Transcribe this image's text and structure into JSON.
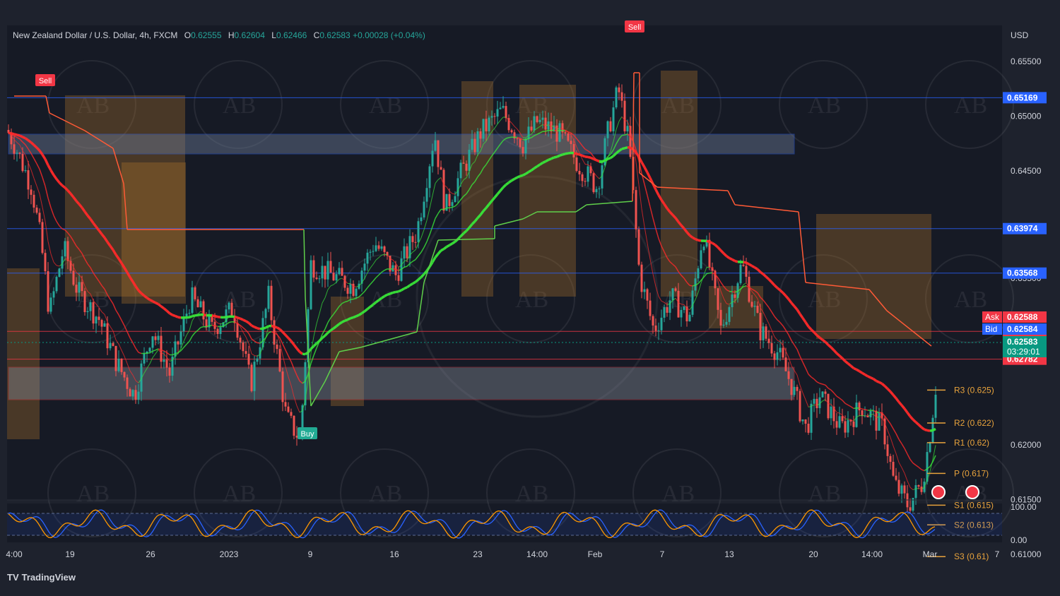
{
  "header": {
    "symbol": "New Zealand Dollar / U.S. Dollar, 4h, FXCM",
    "o_label": "O",
    "o": "0.62555",
    "h_label": "H",
    "h": "0.62604",
    "l_label": "L",
    "l": "0.62466",
    "c_label": "C",
    "c": "0.62583",
    "change": "+0.00028 (+0.04%)"
  },
  "currency": "USD",
  "price_axis": [
    "0.65500",
    "0.65000",
    "0.64500",
    "0.63500",
    "0.62000",
    "0.61500",
    "0.61000"
  ],
  "price_tags": [
    {
      "text": "0.65169",
      "color": "#2962ff",
      "value": 0.65169
    },
    {
      "text": "0.63974",
      "color": "#2962ff",
      "value": 0.63974
    },
    {
      "text": "0.63568",
      "color": "#2962ff",
      "value": 0.63568
    },
    {
      "text": "0.63036",
      "color": "#f23645",
      "value": 0.63036
    },
    {
      "text": "0.62782",
      "color": "#f23645",
      "value": 0.62782
    }
  ],
  "ask": {
    "label": "Ask",
    "value": "0.62588",
    "color": "#f23645"
  },
  "bid": {
    "label": "Bid",
    "value": "0.62584",
    "color": "#2962ff"
  },
  "last": {
    "value": "0.62583",
    "countdown": "03:29:01",
    "color": "#089981"
  },
  "pivots": [
    {
      "label": "R3 (0.625)",
      "value": 0.625
    },
    {
      "label": "R2 (0.622)",
      "value": 0.622
    },
    {
      "label": "R1 (0.62)",
      "value": 0.6202
    },
    {
      "label": "P (0.617)",
      "value": 0.6174
    },
    {
      "label": "S1 (0.615)",
      "value": 0.6145
    },
    {
      "label": "S2 (0.613)",
      "value": 0.6127
    },
    {
      "label": "S3 (0.61)",
      "value": 0.6098
    }
  ],
  "signals": {
    "sell": "Sell",
    "buy": "Buy"
  },
  "time_axis": [
    "4:00",
    "19",
    "26",
    "2023",
    "9",
    "16",
    "23",
    "14:00",
    "Feb",
    "7",
    "13",
    "20",
    "14:00",
    "Mar",
    "7"
  ],
  "oscillator_axis": [
    "100.00",
    "0.00"
  ],
  "brand": {
    "logo": "TV",
    "name": "TradingView"
  },
  "watermark": "AB",
  "colors": {
    "up": "#26a69a",
    "down": "#ef5350",
    "ma_green": "#39e639",
    "ma_red": "#ff2a2a",
    "trail_red": "#ff5a36",
    "trail_green": "#5fcf4a"
  },
  "chart_data": {
    "type": "candlestick",
    "symbol": "NZDUSD",
    "timeframe": "4h",
    "ylim": [
      0.6085,
      0.6565
    ],
    "price_path": [
      [
        0,
        0.65
      ],
      [
        20,
        0.6475
      ],
      [
        45,
        0.6435
      ],
      [
        58,
        0.6385
      ],
      [
        70,
        0.632
      ],
      [
        90,
        0.638
      ],
      [
        110,
        0.634
      ],
      [
        140,
        0.6315
      ],
      [
        165,
        0.6275
      ],
      [
        190,
        0.6245
      ],
      [
        215,
        0.6305
      ],
      [
        240,
        0.6265
      ],
      [
        270,
        0.6335
      ],
      [
        300,
        0.6305
      ],
      [
        330,
        0.6325
      ],
      [
        355,
        0.6255
      ],
      [
        380,
        0.6335
      ],
      [
        405,
        0.6225
      ],
      [
        425,
        0.6205
      ],
      [
        440,
        0.6365
      ],
      [
        470,
        0.6355
      ],
      [
        500,
        0.6345
      ],
      [
        530,
        0.6385
      ],
      [
        560,
        0.6355
      ],
      [
        590,
        0.6395
      ],
      [
        615,
        0.6485
      ],
      [
        630,
        0.6415
      ],
      [
        650,
        0.6445
      ],
      [
        680,
        0.6485
      ],
      [
        710,
        0.6505
      ],
      [
        740,
        0.6475
      ],
      [
        760,
        0.6495
      ],
      [
        790,
        0.6485
      ],
      [
        820,
        0.6455
      ],
      [
        845,
        0.6435
      ],
      [
        860,
        0.6485
      ],
      [
        875,
        0.6525
      ],
      [
        890,
        0.6475
      ],
      [
        905,
        0.6355
      ],
      [
        925,
        0.6305
      ],
      [
        950,
        0.6335
      ],
      [
        975,
        0.6315
      ],
      [
        995,
        0.6395
      ],
      [
        1020,
        0.6305
      ],
      [
        1050,
        0.6365
      ],
      [
        1075,
        0.6305
      ],
      [
        1100,
        0.6285
      ],
      [
        1120,
        0.6255
      ],
      [
        1140,
        0.6215
      ],
      [
        1160,
        0.6245
      ],
      [
        1190,
        0.6215
      ],
      [
        1220,
        0.6235
      ],
      [
        1250,
        0.6215
      ],
      [
        1265,
        0.6165
      ],
      [
        1285,
        0.6145
      ],
      [
        1305,
        0.6165
      ],
      [
        1315,
        0.6205
      ],
      [
        1325,
        0.6258
      ]
    ]
  }
}
